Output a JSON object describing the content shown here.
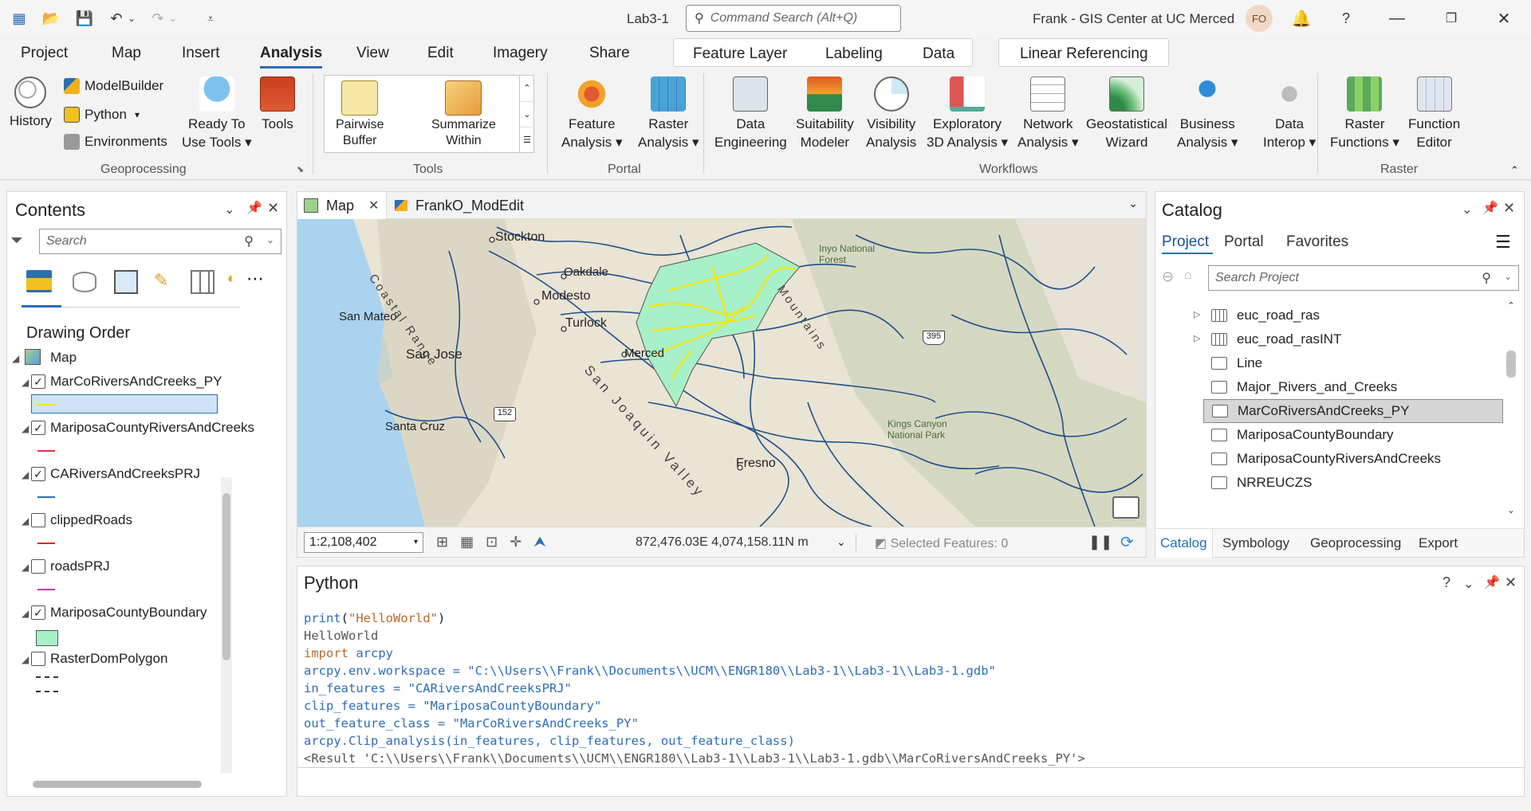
{
  "app": {
    "doc_title": "Lab3-1",
    "user": "Frank - GIS Center at UC Merced",
    "avatar_initials": "FO"
  },
  "command_search": {
    "placeholder": "Command Search (Alt+Q)"
  },
  "ribbon_tabs": [
    "Project",
    "Map",
    "Insert",
    "Analysis",
    "View",
    "Edit",
    "Imagery",
    "Share"
  ],
  "context_tabs": [
    "Feature Layer",
    "Labeling",
    "Data"
  ],
  "context_tab2": "Linear Referencing",
  "active_tab": "Analysis",
  "ribbon": {
    "geoprocessing": {
      "history": "History",
      "modelbuilder": "ModelBuilder",
      "python": "Python",
      "environments": "Environments",
      "ready_to_use": "Ready To",
      "ready_to_use2": "Use Tools",
      "tools": "Tools",
      "label": "Geoprocessing"
    },
    "tools_gallery": {
      "item1a": "Pairwise",
      "item1b": "Buffer",
      "item2a": "Summarize",
      "item2b": "Within",
      "label": "Tools"
    },
    "portal": {
      "feature_a": "Feature",
      "feature_b": "Analysis",
      "raster_a": "Raster",
      "raster_b": "Analysis",
      "label": "Portal"
    },
    "workflows": {
      "items": [
        [
          "Data",
          "Engineering"
        ],
        [
          "Suitability",
          "Modeler"
        ],
        [
          "Visibility",
          "Analysis"
        ],
        [
          "Exploratory",
          "3D Analysis"
        ],
        [
          "Network",
          "Analysis"
        ],
        [
          "Geostatistical",
          "Wizard"
        ],
        [
          "Business",
          "Analysis"
        ],
        [
          "Data",
          "Interop"
        ]
      ],
      "label": "Workflows"
    },
    "raster": {
      "functions_a": "Raster",
      "functions_b": "Functions",
      "editor_a": "Function",
      "editor_b": "Editor",
      "label": "Raster"
    }
  },
  "contents": {
    "title": "Contents",
    "search_placeholder": "Search",
    "drawing_order": "Drawing Order",
    "map_label": "Map",
    "layers": [
      {
        "name": "MarCoRiversAndCreeks_PY",
        "checked": true,
        "color": "#f5e60a"
      },
      {
        "name": "MariposaCountyRiversAndCreeks",
        "checked": true,
        "color": "#e8304a"
      },
      {
        "name": "CARiversAndCreeksPRJ",
        "checked": true,
        "color": "#2d6db5"
      },
      {
        "name": "clippedRoads",
        "checked": false,
        "color": "#e22"
      },
      {
        "name": "roadsPRJ",
        "checked": false,
        "color": "#c040a0"
      },
      {
        "name": "MariposaCountyBoundary",
        "checked": true,
        "color": "#a8f0c8"
      },
      {
        "name": "RasterDomPolygon",
        "checked": false,
        "color": "#333"
      }
    ]
  },
  "map_view": {
    "tabs": [
      "Map",
      "FrankO_ModEdit"
    ],
    "scale": "1:2,108,402",
    "coords": "872,476.03E 4,074,158.11N m",
    "selected": "Selected Features: 0",
    "labels": [
      "Stockton",
      "Oakdale",
      "Modesto",
      "Turlock",
      "Merced",
      "San Mateo",
      "San Jose",
      "Santa Cruz",
      "Fresno",
      "Coastal Range",
      "San Joaquin Valley",
      "Kings Canyon National Park",
      "Inyo National Forest",
      "Mountains",
      "395",
      "152"
    ]
  },
  "catalog": {
    "title": "Catalog",
    "tabs": [
      "Project",
      "Portal",
      "Favorites"
    ],
    "search_placeholder": "Search Project",
    "items": [
      "euc_road_ras",
      "euc_road_rasINT",
      "Line",
      "Major_Rivers_and_Creeks",
      "MarCoRiversAndCreeks_PY",
      "MariposaCountyBoundary",
      "MariposaCountyRiversAndCreeks",
      "NRREUCZS"
    ],
    "bottom_tabs": [
      "Catalog",
      "Symbology",
      "Geoprocessing",
      "Export"
    ]
  },
  "python": {
    "title": "Python",
    "lines": [
      "print(\"HelloWorld\")",
      "HelloWorld",
      "import arcpy",
      "arcpy.env.workspace = \"C:\\\\Users\\\\Frank\\\\Documents\\\\UCM\\\\ENGR180\\\\Lab3-1\\\\Lab3-1\\\\Lab3-1.gdb\"",
      "in_features = \"CARiversAndCreeksPRJ\"",
      "clip_features = \"MariposaCountyBoundary\"",
      "out_feature_class = \"MarCoRiversAndCreeks_PY\"",
      "arcpy.Clip_analysis(in_features, clip_features, out_feature_class)",
      "<Result 'C:\\\\Users\\\\Frank\\\\Documents\\\\UCM\\\\ENGR180\\\\Lab3-1\\\\Lab3-1\\\\Lab3-1.gdb\\\\MarCoRiversAndCreeks_PY'>"
    ]
  }
}
